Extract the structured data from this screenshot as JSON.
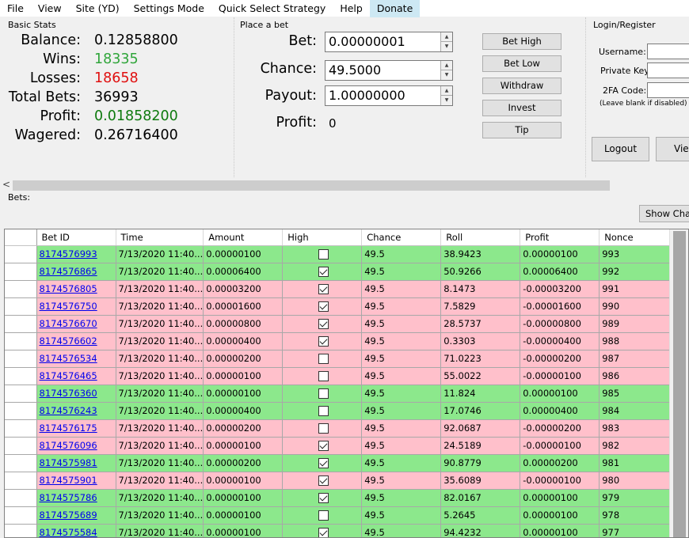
{
  "menu": [
    "File",
    "View",
    "Site (YD)",
    "Settings Mode",
    "Quick Select Strategy",
    "Help",
    "Donate"
  ],
  "stats": {
    "title": "Basic Stats",
    "balance_label": "Balance:",
    "balance": "0.12858800",
    "wins_label": "Wins:",
    "wins": "18335",
    "losses_label": "Losses:",
    "losses": "18658",
    "total_label": "Total Bets:",
    "total": "36993",
    "profit_label": "Profit:",
    "profit": "0.01858200",
    "wagered_label": "Wagered:",
    "wagered": "0.26716400"
  },
  "bet": {
    "title": "Place a bet",
    "bet_label": "Bet:",
    "bet_value": "0.00000001",
    "chance_label": "Chance:",
    "chance_value": "49.5000",
    "payout_label": "Payout:",
    "payout_value": "1.00000000",
    "profit_label": "Profit:",
    "profit_value": "0",
    "buttons": [
      "Bet High",
      "Bet Low",
      "Withdraw",
      "Invest",
      "Tip"
    ]
  },
  "login": {
    "title": "Login/Register",
    "username_label": "Username:",
    "private_key_label": "Private Key",
    "twofa_label": "2FA Code:",
    "twofa_hint": "(Leave blank if disabled)",
    "login_button": "Logout",
    "view_button": "View"
  },
  "bets_label": "Bets:",
  "show_chart": "Show Chart",
  "columns": [
    "Bet ID",
    "Time",
    "Amount",
    "High",
    "Chance",
    "Roll",
    "Profit",
    "Nonce"
  ],
  "rows": [
    {
      "id": "8174576993",
      "time": "7/13/2020 11:40...",
      "amount": "0.00000100",
      "high": false,
      "chance": "49.5",
      "roll": "38.9423",
      "profit": "0.00000100",
      "nonce": "993",
      "win": true
    },
    {
      "id": "8174576865",
      "time": "7/13/2020 11:40...",
      "amount": "0.00006400",
      "high": true,
      "chance": "49.5",
      "roll": "50.9266",
      "profit": "0.00006400",
      "nonce": "992",
      "win": true
    },
    {
      "id": "8174576805",
      "time": "7/13/2020 11:40...",
      "amount": "0.00003200",
      "high": true,
      "chance": "49.5",
      "roll": "8.1473",
      "profit": "-0.00003200",
      "nonce": "991",
      "win": false
    },
    {
      "id": "8174576750",
      "time": "7/13/2020 11:40...",
      "amount": "0.00001600",
      "high": true,
      "chance": "49.5",
      "roll": "7.5829",
      "profit": "-0.00001600",
      "nonce": "990",
      "win": false
    },
    {
      "id": "8174576670",
      "time": "7/13/2020 11:40...",
      "amount": "0.00000800",
      "high": true,
      "chance": "49.5",
      "roll": "28.5737",
      "profit": "-0.00000800",
      "nonce": "989",
      "win": false
    },
    {
      "id": "8174576602",
      "time": "7/13/2020 11:40...",
      "amount": "0.00000400",
      "high": true,
      "chance": "49.5",
      "roll": "0.3303",
      "profit": "-0.00000400",
      "nonce": "988",
      "win": false
    },
    {
      "id": "8174576534",
      "time": "7/13/2020 11:40...",
      "amount": "0.00000200",
      "high": false,
      "chance": "49.5",
      "roll": "71.0223",
      "profit": "-0.00000200",
      "nonce": "987",
      "win": false
    },
    {
      "id": "8174576465",
      "time": "7/13/2020 11:40...",
      "amount": "0.00000100",
      "high": false,
      "chance": "49.5",
      "roll": "55.0022",
      "profit": "-0.00000100",
      "nonce": "986",
      "win": false
    },
    {
      "id": "8174576360",
      "time": "7/13/2020 11:40...",
      "amount": "0.00000100",
      "high": false,
      "chance": "49.5",
      "roll": "11.824",
      "profit": "0.00000100",
      "nonce": "985",
      "win": true
    },
    {
      "id": "8174576243",
      "time": "7/13/2020 11:40...",
      "amount": "0.00000400",
      "high": false,
      "chance": "49.5",
      "roll": "17.0746",
      "profit": "0.00000400",
      "nonce": "984",
      "win": true
    },
    {
      "id": "8174576175",
      "time": "7/13/2020 11:40...",
      "amount": "0.00000200",
      "high": false,
      "chance": "49.5",
      "roll": "92.0687",
      "profit": "-0.00000200",
      "nonce": "983",
      "win": false
    },
    {
      "id": "8174576096",
      "time": "7/13/2020 11:40...",
      "amount": "0.00000100",
      "high": true,
      "chance": "49.5",
      "roll": "24.5189",
      "profit": "-0.00000100",
      "nonce": "982",
      "win": false
    },
    {
      "id": "8174575981",
      "time": "7/13/2020 11:40...",
      "amount": "0.00000200",
      "high": true,
      "chance": "49.5",
      "roll": "90.8779",
      "profit": "0.00000200",
      "nonce": "981",
      "win": true
    },
    {
      "id": "8174575901",
      "time": "7/13/2020 11:40...",
      "amount": "0.00000100",
      "high": true,
      "chance": "49.5",
      "roll": "35.6089",
      "profit": "-0.00000100",
      "nonce": "980",
      "win": false
    },
    {
      "id": "8174575786",
      "time": "7/13/2020 11:40...",
      "amount": "0.00000100",
      "high": true,
      "chance": "49.5",
      "roll": "82.0167",
      "profit": "0.00000100",
      "nonce": "979",
      "win": true
    },
    {
      "id": "8174575689",
      "time": "7/13/2020 11:40...",
      "amount": "0.00000100",
      "high": false,
      "chance": "49.5",
      "roll": "5.2645",
      "profit": "0.00000100",
      "nonce": "978",
      "win": true
    },
    {
      "id": "8174575584",
      "time": "7/13/2020 11:40...",
      "amount": "0.00000100",
      "high": true,
      "chance": "49.5",
      "roll": "94.4232",
      "profit": "0.00000100",
      "nonce": "977",
      "win": true
    }
  ]
}
